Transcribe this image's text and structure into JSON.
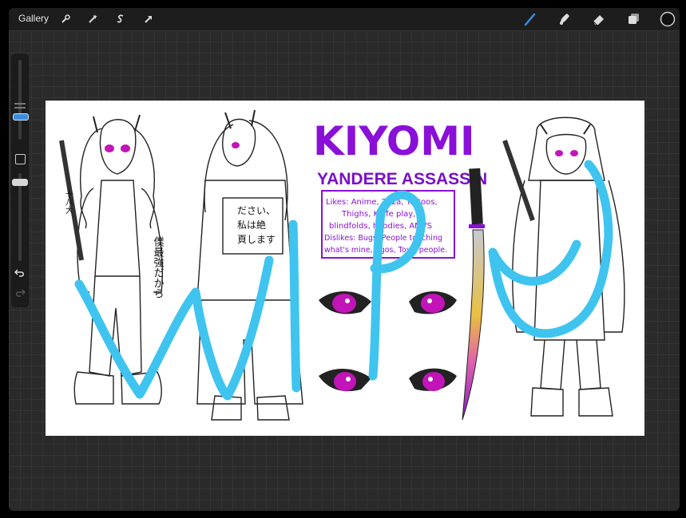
{
  "topbar": {
    "gallery_label": "Gallery",
    "left_tools": [
      "wrench-icon",
      "magic-wand-icon",
      "selection-icon",
      "transform-arrow-icon"
    ],
    "right_tools": [
      "brush-icon",
      "smudge-icon",
      "eraser-icon",
      "layers-icon",
      "color-swatch"
    ],
    "active_color": "#111111",
    "accent": "#3a8dde"
  },
  "sidebar": {
    "tools": [
      "brush-size-slider",
      "modify-square-button",
      "opacity-slider",
      "undo-arrow-icon",
      "redo-arrow-icon"
    ]
  },
  "artwork": {
    "title": "KIYOMI",
    "subtitle": "YANDERE ASSASSIN",
    "info_lines": [
      "Likes: Anime, Zaza, Tattoos,",
      "Thighs, Knife play,",
      "blindfolds, hoodies, AMVS",
      "Dislikes: Bugs, People touching",
      "what's mine, Egos, Toxic people."
    ],
    "sleeve_text": "僕最強だから",
    "jacket_text_lines": [
      "ださい、",
      "私は絶",
      "頁します"
    ],
    "side_kanji": "十八大",
    "wip_letters": "WIP",
    "colors": {
      "title_purple": "#8a10d8",
      "eye_magenta": "#c214b8",
      "wip_blue": "#3fc4f0"
    }
  }
}
